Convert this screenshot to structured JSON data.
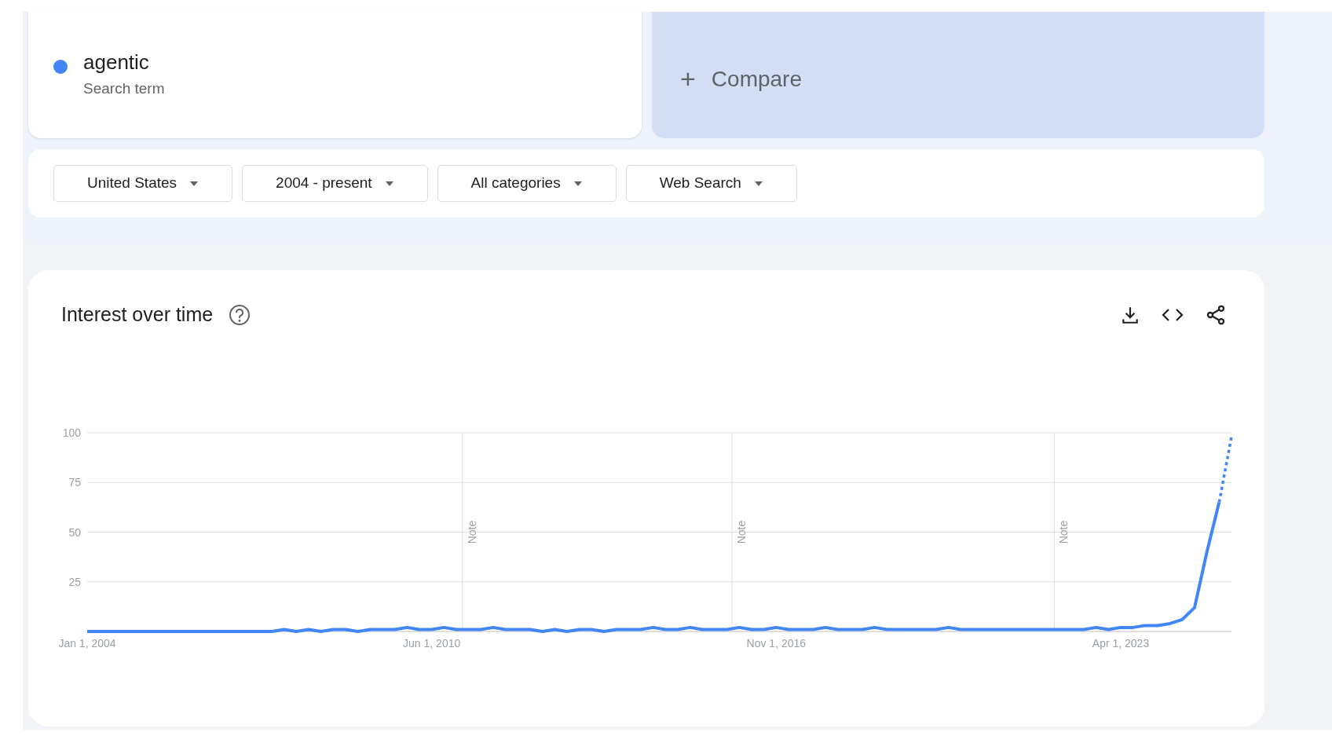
{
  "search_term": {
    "name": "agentic",
    "subtitle": "Search term",
    "color": "#4285f4"
  },
  "compare": {
    "icon": "+",
    "label": "Compare"
  },
  "filters": [
    {
      "label": "United States"
    },
    {
      "label": "2004 - present"
    },
    {
      "label": "All categories"
    },
    {
      "label": "Web Search"
    }
  ],
  "interest_over_time": {
    "title": "Interest over time",
    "chart_data": {
      "type": "line",
      "grid": true,
      "ylim": [
        0,
        100
      ],
      "yticks": [
        25,
        50,
        75,
        100
      ],
      "categories": [
        "Jan 1, 2004",
        null,
        null,
        null,
        null,
        null,
        null,
        null,
        null,
        null,
        null,
        null,
        null,
        null,
        null,
        null,
        null,
        null,
        null,
        null,
        null,
        null,
        null,
        null,
        null,
        null,
        null,
        null,
        "Jun 1, 2010",
        null,
        null,
        null,
        null,
        null,
        null,
        null,
        null,
        null,
        null,
        null,
        null,
        null,
        null,
        null,
        null,
        null,
        null,
        null,
        null,
        null,
        null,
        null,
        null,
        null,
        null,
        null,
        "Nov 1, 2016",
        null,
        null,
        null,
        null,
        null,
        null,
        null,
        null,
        null,
        null,
        null,
        null,
        null,
        null,
        null,
        null,
        null,
        null,
        null,
        null,
        null,
        null,
        null,
        null,
        null,
        null,
        null,
        "Apr 1, 2023",
        null,
        null,
        null,
        null,
        null,
        null,
        null,
        null,
        null
      ],
      "series": [
        {
          "color": "#4285f4",
          "values": [
            0,
            0,
            0,
            0,
            0,
            0,
            0,
            0,
            0,
            0,
            0,
            0,
            0,
            0,
            0,
            0,
            1,
            0,
            1,
            0,
            1,
            1,
            0,
            1,
            1,
            1,
            2,
            1,
            1,
            2,
            1,
            1,
            1,
            2,
            1,
            1,
            1,
            0,
            1,
            0,
            1,
            1,
            0,
            1,
            1,
            1,
            2,
            1,
            1,
            2,
            1,
            1,
            1,
            2,
            1,
            1,
            2,
            1,
            1,
            1,
            2,
            1,
            1,
            1,
            2,
            1,
            1,
            1,
            1,
            1,
            2,
            1,
            1,
            1,
            1,
            1,
            1,
            1,
            1,
            1,
            1,
            1,
            2,
            1,
            2,
            2,
            3,
            3,
            4,
            6,
            12,
            40,
            65,
            98
          ]
        }
      ],
      "annotations": [
        "Note",
        "Note",
        "Note"
      ]
    }
  }
}
